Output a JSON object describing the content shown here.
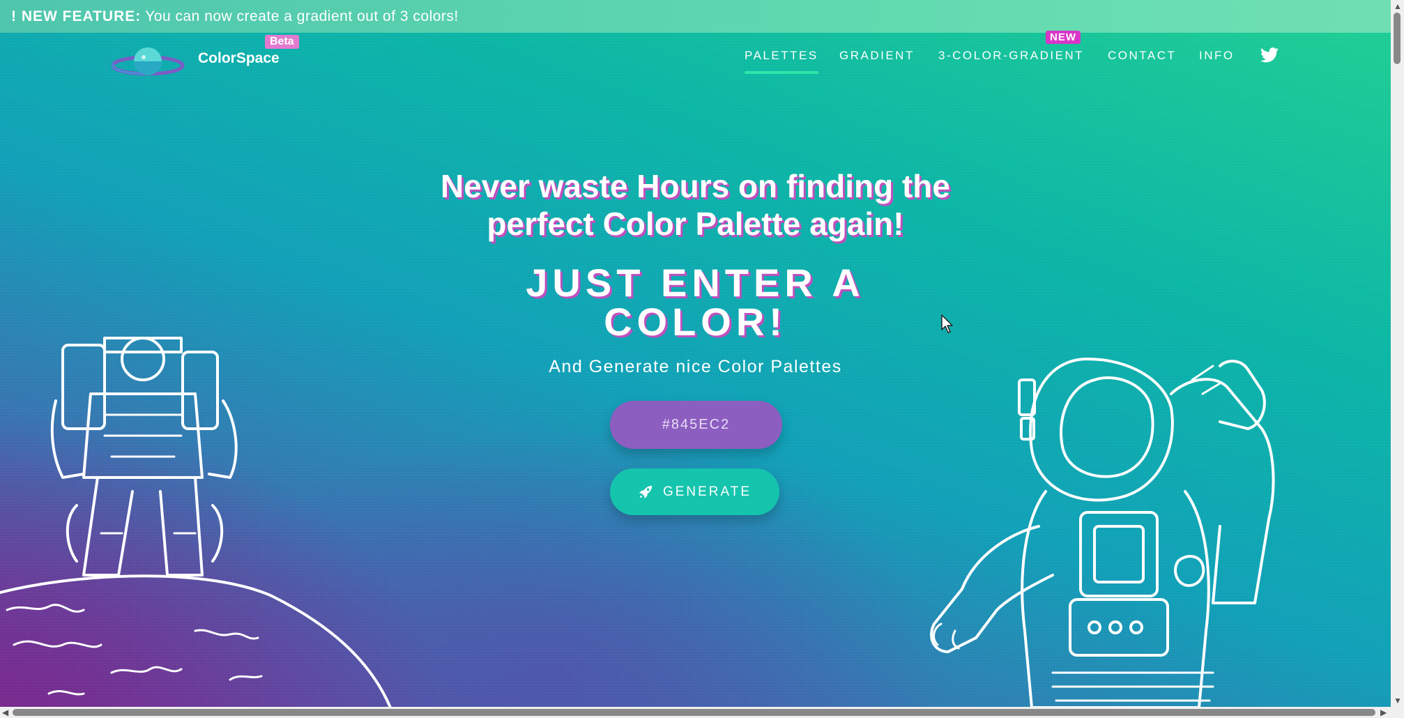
{
  "banner": {
    "label": "! NEW FEATURE:",
    "text": "You can now create a gradient out of 3 colors!"
  },
  "brand": {
    "name": "ColorSpace",
    "badge": "Beta"
  },
  "nav": {
    "items": [
      {
        "label": "PALETTES",
        "active": true
      },
      {
        "label": "GRADIENT"
      },
      {
        "label": "3-COLOR-GRADIENT",
        "badge": "NEW"
      },
      {
        "label": "CONTACT"
      },
      {
        "label": "INFO"
      }
    ],
    "social_icon": "twitter-icon"
  },
  "hero": {
    "title_line1": "Never waste Hours on finding the",
    "title_line2": "perfect Color Palette again!",
    "headline_line1": "JUST ENTER A",
    "headline_line2": "COLOR!",
    "subtitle": "And Generate nice Color Palettes"
  },
  "form": {
    "color_value": "#845EC2",
    "generate_label": "GENERATE",
    "generate_icon": "rocket-icon"
  },
  "colors": {
    "input_bg": "#845EC2",
    "button_bg": "#15C4AD",
    "accent_pink": "#D936C9",
    "nav_underline": "#2EE6A8"
  }
}
